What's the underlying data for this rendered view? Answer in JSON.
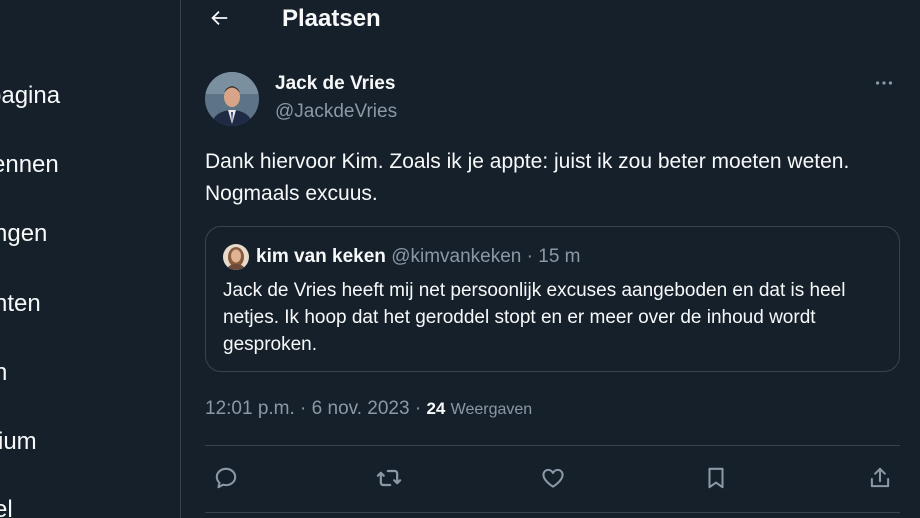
{
  "sidebar": {
    "items": [
      {
        "label": "pagina"
      },
      {
        "label": "ennen"
      },
      {
        "label": "ngen"
      },
      {
        "label": "hten"
      },
      {
        "label": "n"
      },
      {
        "label": "ium"
      },
      {
        "label": "el"
      }
    ]
  },
  "header": {
    "back_icon": "arrow-left-icon",
    "title": "Plaatsen"
  },
  "tweet": {
    "author_name": "Jack de Vries",
    "author_handle": "@JackdeVries",
    "more_icon": "more-horizontal-icon",
    "text": "Dank hiervoor Kim. Zoals ik je appte: juist ik zou beter moeten weten. Nogmaals excuus.",
    "quote": {
      "name": "kim van keken",
      "handle": "@kimvankeken",
      "separator": " · ",
      "time": "15 m",
      "text": "Jack de Vries heeft mij net persoonlijk excuses aangeboden en dat is heel netjes. Ik hoop dat het geroddel stopt en er meer over de inhoud wordt gesproken."
    },
    "timestamp": "12:01 p.m. · 6 nov. 2023 · ",
    "views_count": "24",
    "views_label": "Weergaven"
  },
  "actions": [
    {
      "icon": "reply-icon"
    },
    {
      "icon": "retweet-icon"
    },
    {
      "icon": "like-icon"
    },
    {
      "icon": "bookmark-icon"
    },
    {
      "icon": "share-icon"
    }
  ],
  "colors": {
    "background": "#15202b",
    "text": "#f7f9f9",
    "secondary_text": "#8b98a5",
    "border": "#38444d"
  }
}
